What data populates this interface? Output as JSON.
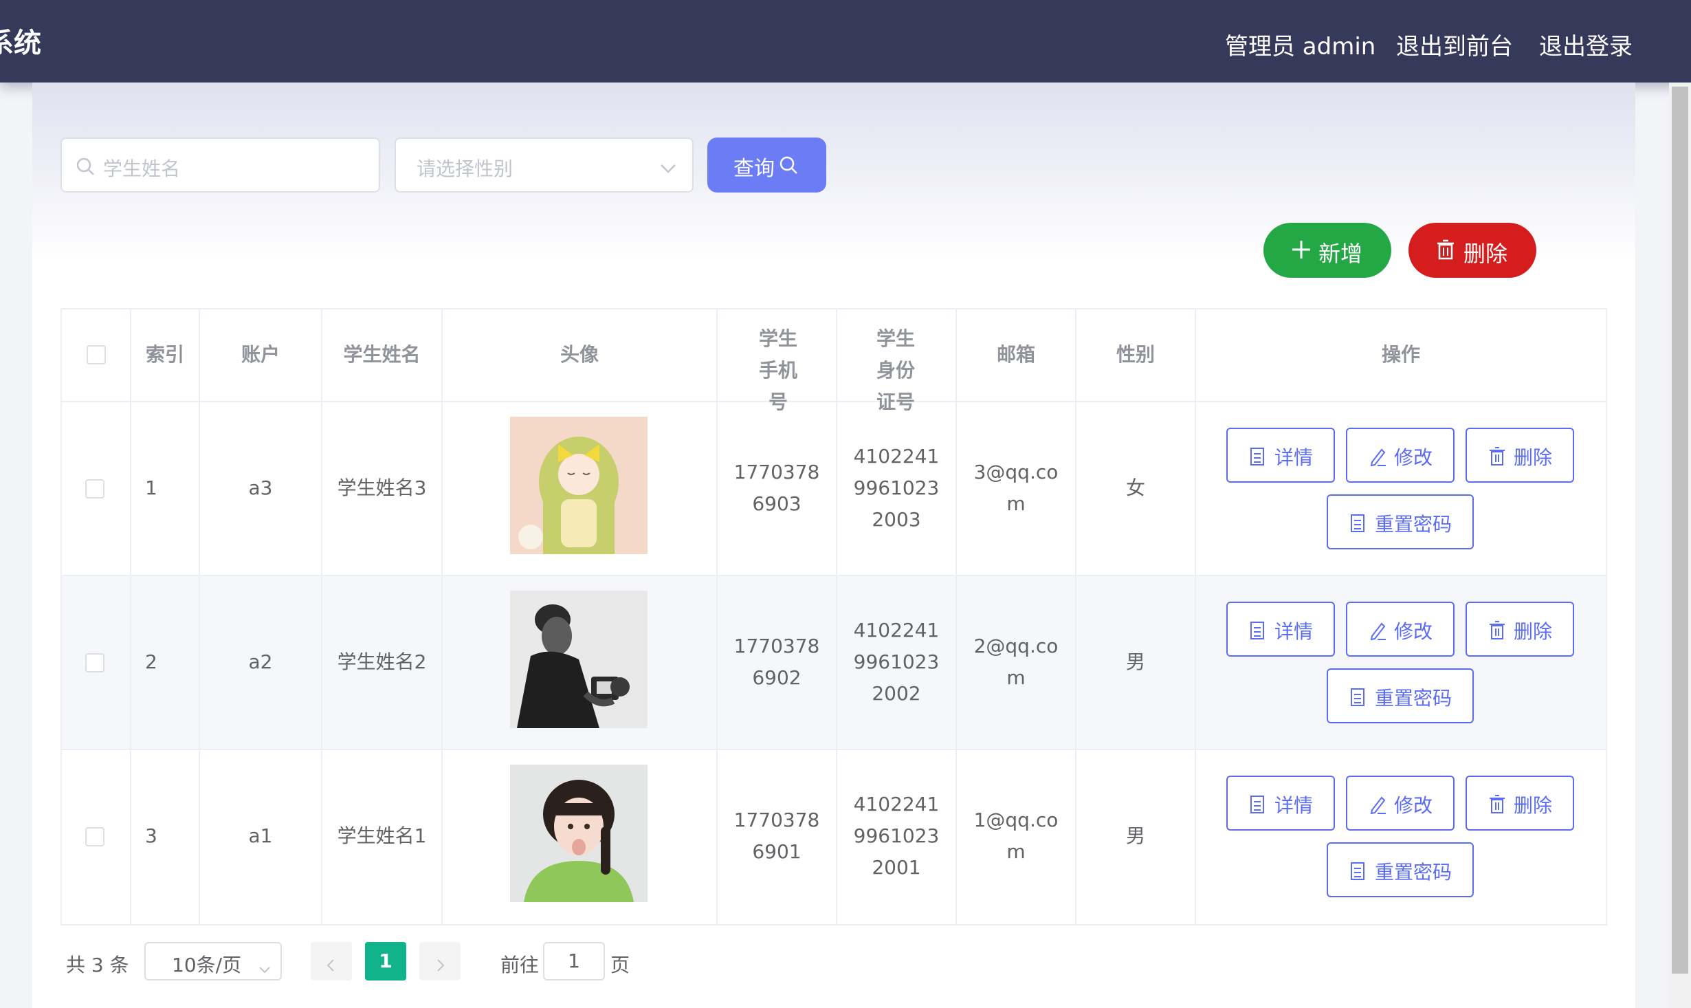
{
  "header": {
    "brand": "系统",
    "admin_label": "管理员 admin",
    "front_link": "退出到前台",
    "logout_link": "退出登录"
  },
  "filters": {
    "name_placeholder": "学生姓名",
    "gender_placeholder": "请选择性别",
    "search_label": "查询"
  },
  "actions": {
    "add_label": "新增",
    "delete_label": "删除"
  },
  "table": {
    "headers": [
      "索引",
      "账户",
      "学生姓名",
      "头像",
      "学生手机号",
      "学生身份证号",
      "邮箱",
      "性别",
      "操作"
    ],
    "rows": [
      {
        "index": "1",
        "account": "a3",
        "name": "学生姓名3",
        "phone": "17703786903",
        "id_number": "410224199610232003",
        "email": "3@qq.com",
        "gender": "女",
        "avatar": "anime-girl-avatar"
      },
      {
        "index": "2",
        "account": "a2",
        "name": "学生姓名2",
        "phone": "17703786902",
        "id_number": "410224199610232002",
        "email": "2@qq.com",
        "gender": "男",
        "avatar": "man-with-camera-avatar"
      },
      {
        "index": "3",
        "account": "a1",
        "name": "学生姓名1",
        "phone": "17703786901",
        "id_number": "410224199610232001",
        "email": "1@qq.com",
        "gender": "男",
        "avatar": "girl-green-sweater-avatar"
      }
    ],
    "row_actions": {
      "detail": "详情",
      "edit": "修改",
      "delete": "删除",
      "reset_password": "重置密码"
    }
  },
  "pagination": {
    "total_text": "共 3 条",
    "page_size": "10条/页",
    "current_page": "1",
    "goto_prefix": "前往",
    "goto_value": "1",
    "goto_suffix": "页"
  },
  "colors": {
    "header_bg": "#363a5a",
    "primary": "#6b7cf5",
    "success": "#24a845",
    "danger": "#d61d1d",
    "pager_active": "#11b48a"
  }
}
